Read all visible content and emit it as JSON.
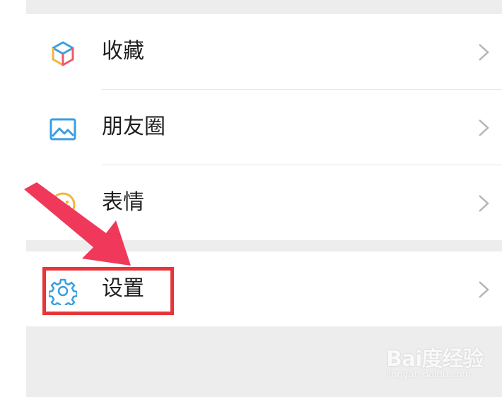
{
  "menu": {
    "items": [
      {
        "label": "收藏",
        "icon": "favorites-cube-icon"
      },
      {
        "label": "朋友圈",
        "icon": "moments-picture-icon"
      },
      {
        "label": "表情",
        "icon": "sticker-smiley-icon"
      }
    ],
    "settings": {
      "label": "设置",
      "icon": "settings-gear-icon"
    }
  },
  "annotation": {
    "box_color": "#e8353a",
    "arrow_color": "#f0395a"
  },
  "watermark": {
    "brand": "Bai度经验",
    "url": "jingyan.baidu.com"
  },
  "colors": {
    "background": "#ededed",
    "card": "#ffffff",
    "icon_blue": "#3a9ee3",
    "icon_yellow": "#f2b43c"
  }
}
